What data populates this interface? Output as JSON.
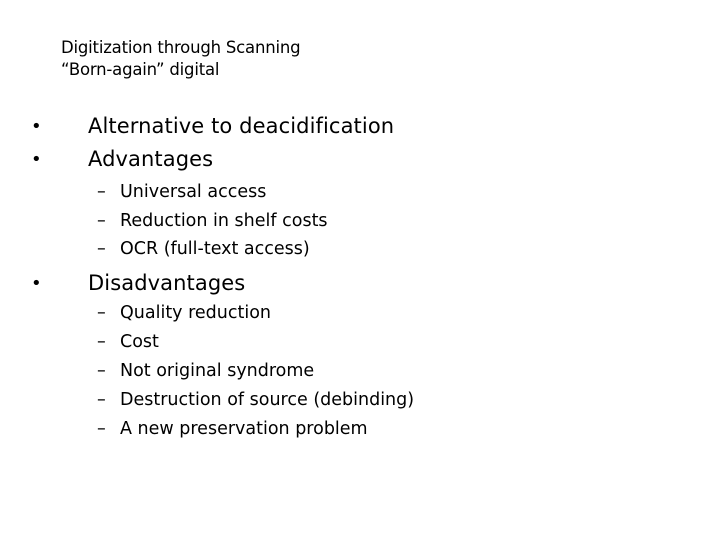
{
  "slide": {
    "title_lines": [
      "Digitization through Scanning",
      "“Born-again” digital"
    ],
    "bullets": [
      {
        "marker": "•",
        "text": "Alternative to deacidification",
        "sub": []
      },
      {
        "marker": "•",
        "text": "Advantages",
        "sub": [
          {
            "marker": "–",
            "text": "Universal access"
          },
          {
            "marker": "–",
            "text": "Reduction in shelf costs"
          },
          {
            "marker": "–",
            "text": "OCR (full-text access)"
          }
        ]
      },
      {
        "marker": "•",
        "text": "Disadvantages",
        "sub": [
          {
            "marker": "–",
            "text": "Quality reduction"
          },
          {
            "marker": "–",
            "text": "Cost"
          },
          {
            "marker": "–",
            "text": "Not original syndrome"
          },
          {
            "marker": "–",
            "text": "Destruction of source (debinding)"
          },
          {
            "marker": "–",
            "text": "A new preservation problem"
          }
        ]
      }
    ],
    "colors": {
      "background": "#ffffff",
      "text": "#000000"
    }
  }
}
